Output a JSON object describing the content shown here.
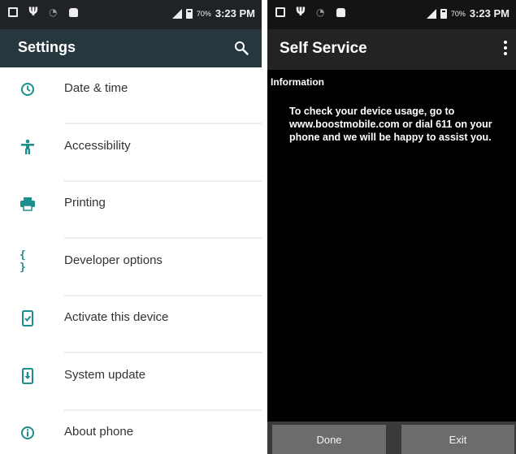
{
  "left_screen": {
    "status_bar": {
      "battery": "70%",
      "time": "3:23 PM"
    },
    "toolbar": {
      "title": "Settings",
      "search_icon": "search-icon"
    },
    "items": [
      {
        "label": "Date & time",
        "icon": "clock-icon"
      },
      {
        "label": "Accessibility",
        "icon": "accessibility-icon"
      },
      {
        "label": "Printing",
        "icon": "printer-icon"
      },
      {
        "label": "Developer options",
        "icon": "braces-icon"
      },
      {
        "label": "Activate this device",
        "icon": "activate-device-icon"
      },
      {
        "label": "System update",
        "icon": "system-update-icon"
      },
      {
        "label": "About phone",
        "icon": "info-icon"
      }
    ],
    "accent_color": "#1b8f8a",
    "toolbar_color": "#26373d"
  },
  "right_screen": {
    "status_bar": {
      "battery": "70%",
      "time": "3:23 PM"
    },
    "toolbar": {
      "title": "Self Service",
      "menu_icon": "overflow-menu-icon"
    },
    "section_heading": "Information",
    "message": "To check your device usage, go to\nwww.boostmobile.com or dial 611 on your\nphone and we will be happy to assist you.",
    "buttons": {
      "done": "Done",
      "exit": "Exit"
    }
  }
}
